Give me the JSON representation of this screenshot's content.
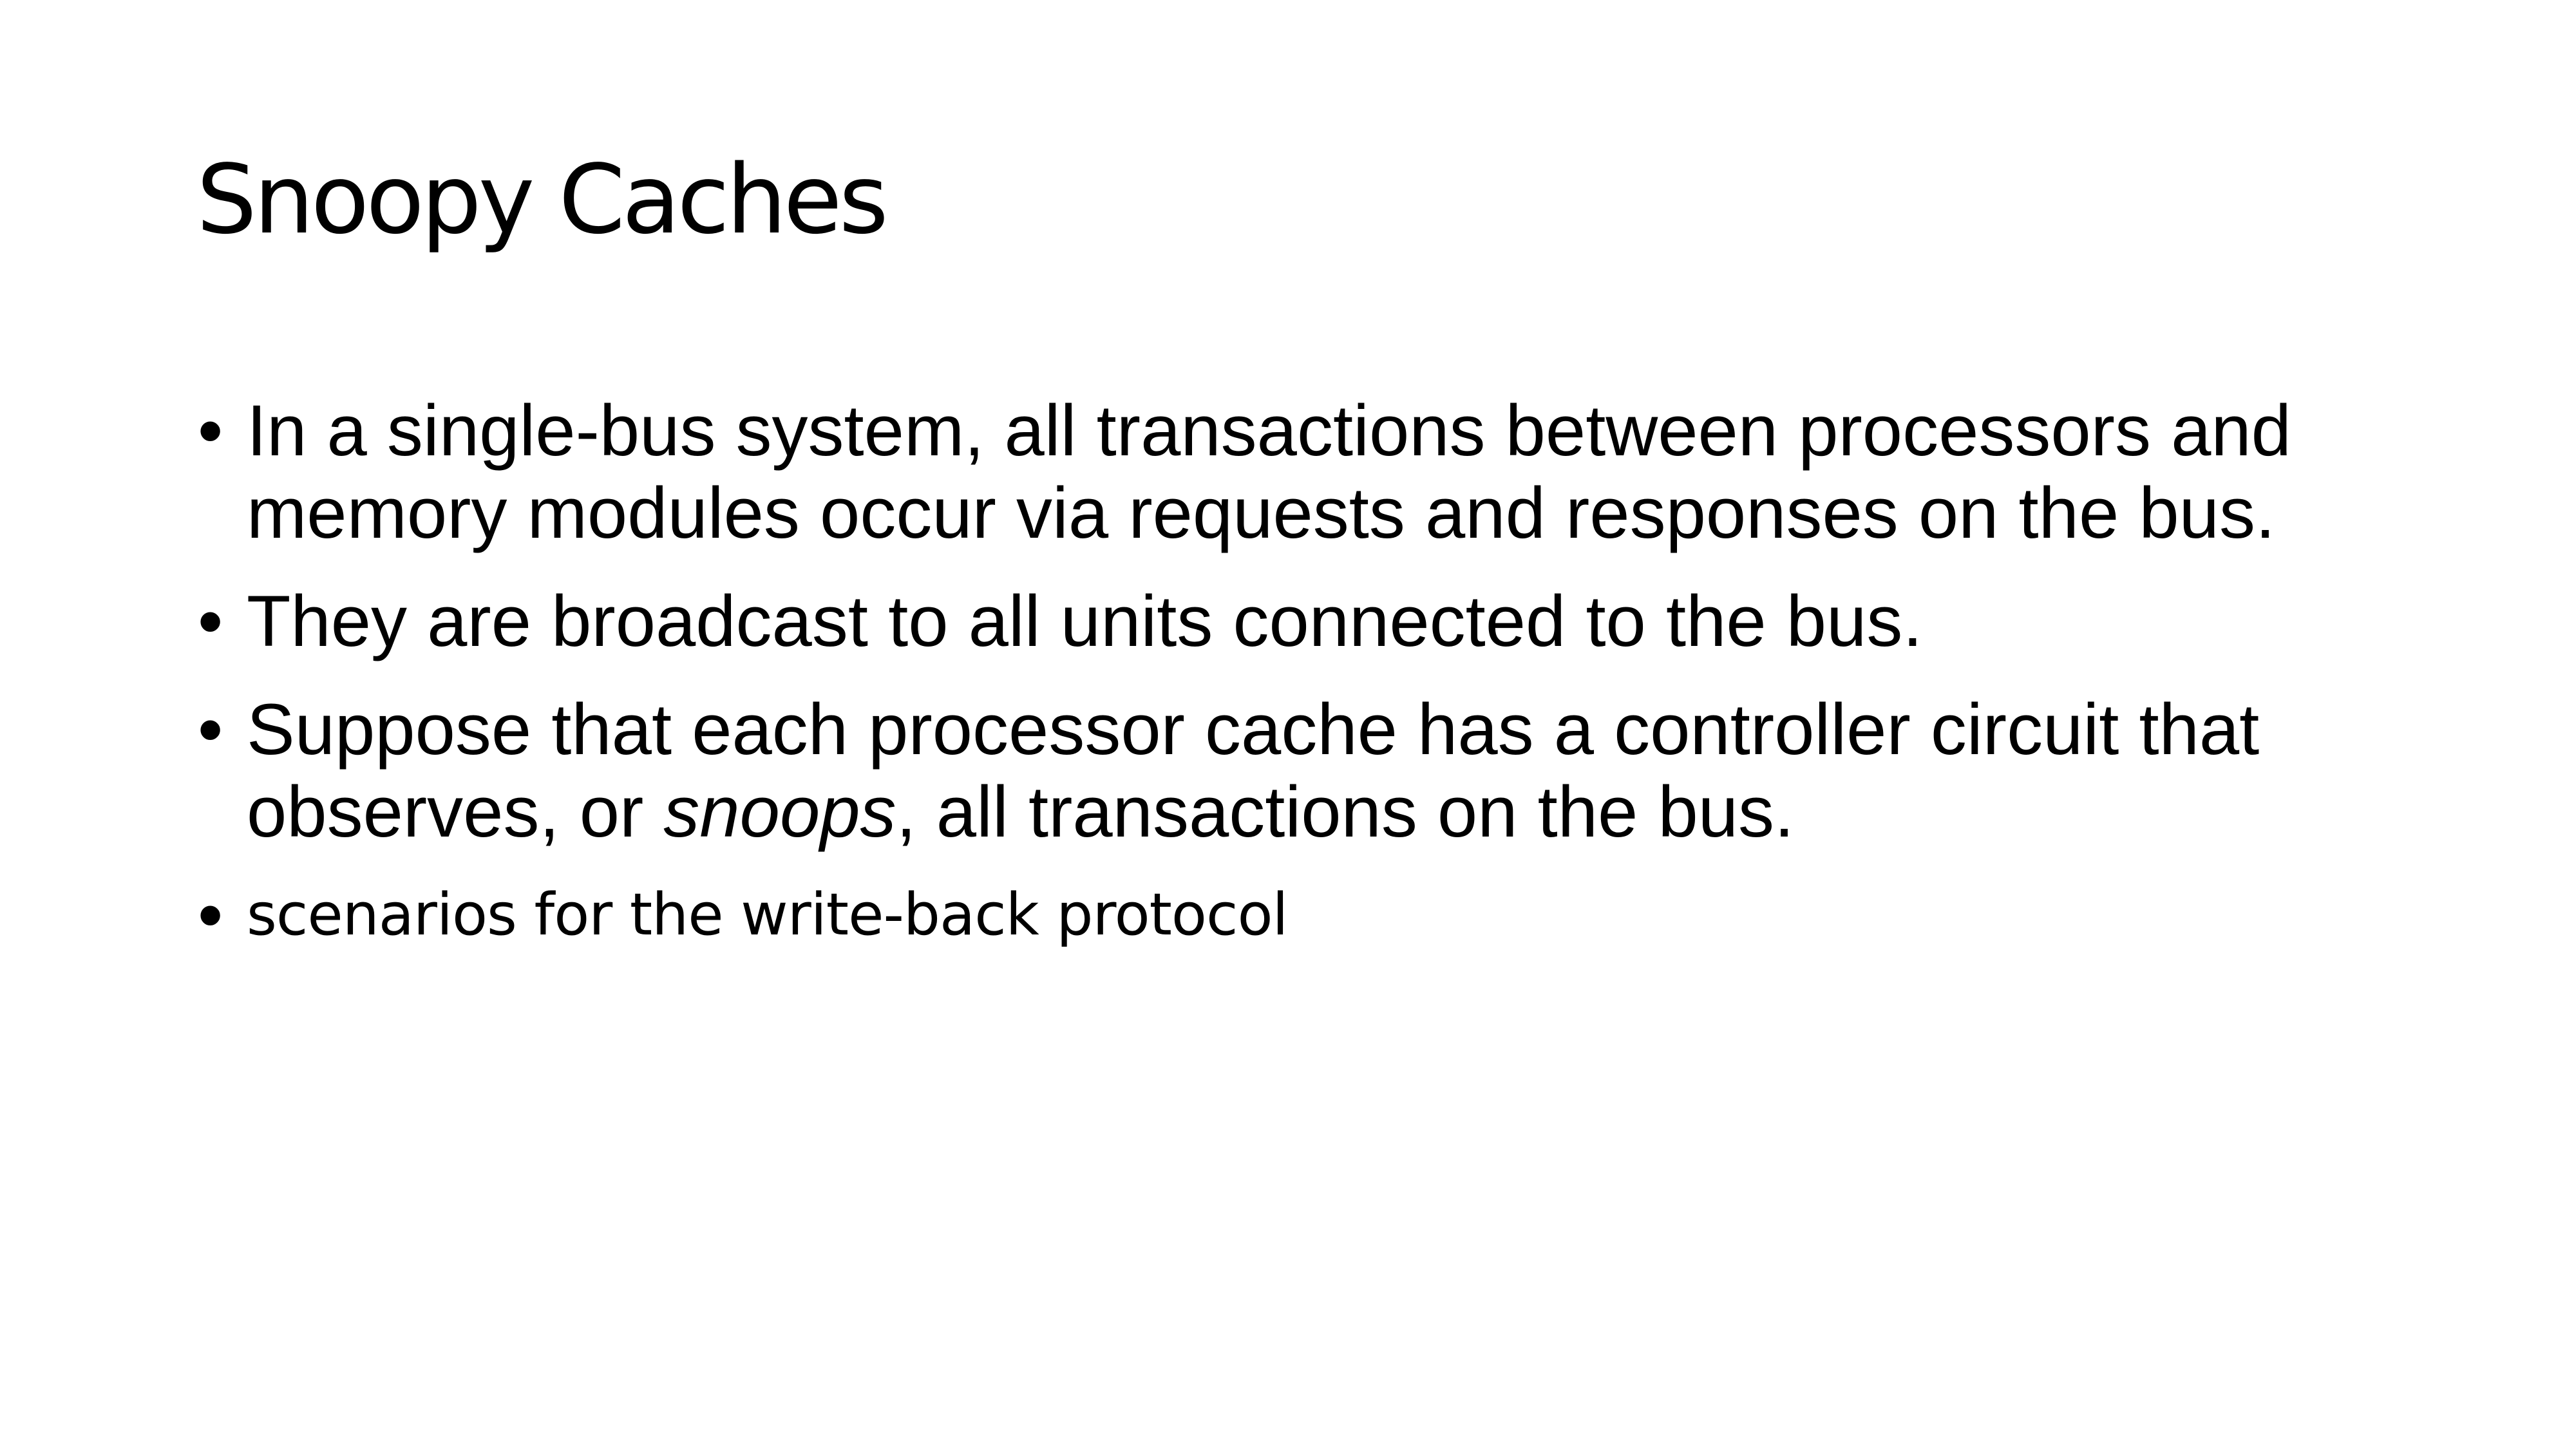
{
  "slide": {
    "title": "Snoopy Caches",
    "bullets": [
      {
        "text": "In a single-bus system, all transactions between processors and memory modules occur via requests and responses on the bus."
      },
      {
        "text": "They are broadcast to all units connected to the bus."
      },
      {
        "text_before": "Suppose that each processor cache has a controller circuit that observes, or ",
        "emphasis": "snoops",
        "text_after": ", all transactions on the bus."
      },
      {
        "text": "scenarios for the write-back protocol"
      }
    ],
    "bullet_symbol": "•"
  }
}
